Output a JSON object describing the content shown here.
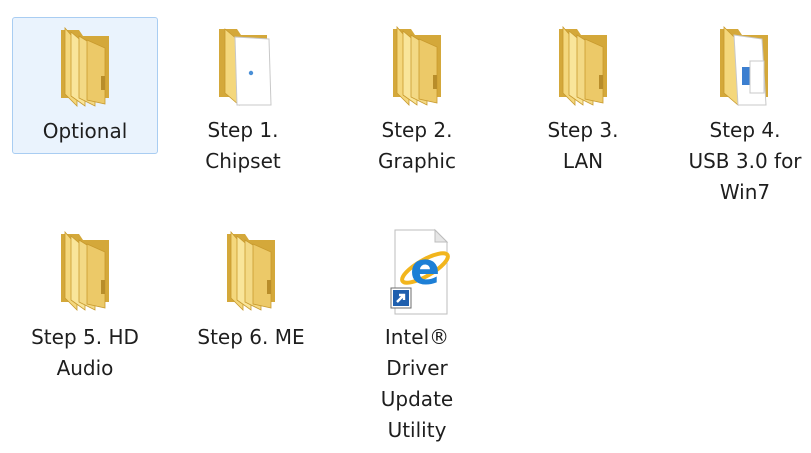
{
  "items": [
    {
      "label": "Optional",
      "icon": "folder-icon",
      "selected": true
    },
    {
      "label": "Step 1.\nChipset",
      "icon": "folder-document-icon",
      "selected": false
    },
    {
      "label": "Step 2.\nGraphic",
      "icon": "folder-icon",
      "selected": false
    },
    {
      "label": "Step 3.\nLAN",
      "icon": "folder-icon",
      "selected": false
    },
    {
      "label": "Step 4.\nUSB 3.0 for\nWin7",
      "icon": "folder-document-icon",
      "selected": false
    },
    {
      "label": "Step 5. HD\nAudio",
      "icon": "folder-icon",
      "selected": false
    },
    {
      "label": "Step 6. ME",
      "icon": "folder-icon",
      "selected": false
    },
    {
      "label": "Intel®\nDriver\nUpdate\nUtility",
      "icon": "internet-explorer-shortcut-icon",
      "selected": false
    }
  ],
  "colors": {
    "folder_light": "#f9e59a",
    "folder_mid": "#ecc968",
    "folder_dark": "#d4a83a",
    "selection_fill": "#eaf3fd",
    "selection_border": "#a9cdf2",
    "ie_blue": "#1d7fd6",
    "ie_gold": "#f2b51d"
  }
}
